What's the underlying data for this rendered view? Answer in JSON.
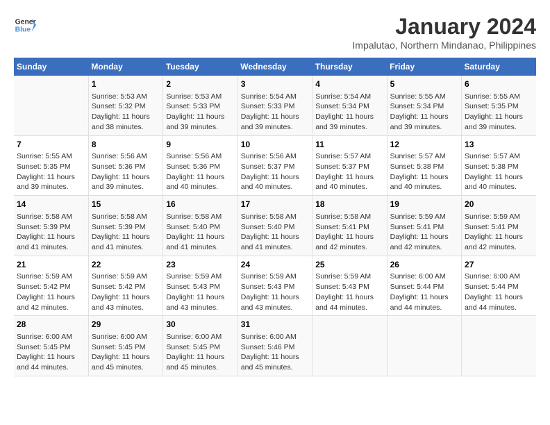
{
  "logo": {
    "line1": "General",
    "line2": "Blue"
  },
  "title": "January 2024",
  "subtitle": "Impalutao, Northern Mindanao, Philippines",
  "days_of_week": [
    "Sunday",
    "Monday",
    "Tuesday",
    "Wednesday",
    "Thursday",
    "Friday",
    "Saturday"
  ],
  "weeks": [
    [
      {
        "day": "",
        "info": ""
      },
      {
        "day": "1",
        "info": "Sunrise: 5:53 AM\nSunset: 5:32 PM\nDaylight: 11 hours\nand 38 minutes."
      },
      {
        "day": "2",
        "info": "Sunrise: 5:53 AM\nSunset: 5:33 PM\nDaylight: 11 hours\nand 39 minutes."
      },
      {
        "day": "3",
        "info": "Sunrise: 5:54 AM\nSunset: 5:33 PM\nDaylight: 11 hours\nand 39 minutes."
      },
      {
        "day": "4",
        "info": "Sunrise: 5:54 AM\nSunset: 5:34 PM\nDaylight: 11 hours\nand 39 minutes."
      },
      {
        "day": "5",
        "info": "Sunrise: 5:55 AM\nSunset: 5:34 PM\nDaylight: 11 hours\nand 39 minutes."
      },
      {
        "day": "6",
        "info": "Sunrise: 5:55 AM\nSunset: 5:35 PM\nDaylight: 11 hours\nand 39 minutes."
      }
    ],
    [
      {
        "day": "7",
        "info": "Sunrise: 5:55 AM\nSunset: 5:35 PM\nDaylight: 11 hours\nand 39 minutes."
      },
      {
        "day": "8",
        "info": "Sunrise: 5:56 AM\nSunset: 5:36 PM\nDaylight: 11 hours\nand 39 minutes."
      },
      {
        "day": "9",
        "info": "Sunrise: 5:56 AM\nSunset: 5:36 PM\nDaylight: 11 hours\nand 40 minutes."
      },
      {
        "day": "10",
        "info": "Sunrise: 5:56 AM\nSunset: 5:37 PM\nDaylight: 11 hours\nand 40 minutes."
      },
      {
        "day": "11",
        "info": "Sunrise: 5:57 AM\nSunset: 5:37 PM\nDaylight: 11 hours\nand 40 minutes."
      },
      {
        "day": "12",
        "info": "Sunrise: 5:57 AM\nSunset: 5:38 PM\nDaylight: 11 hours\nand 40 minutes."
      },
      {
        "day": "13",
        "info": "Sunrise: 5:57 AM\nSunset: 5:38 PM\nDaylight: 11 hours\nand 40 minutes."
      }
    ],
    [
      {
        "day": "14",
        "info": "Sunrise: 5:58 AM\nSunset: 5:39 PM\nDaylight: 11 hours\nand 41 minutes."
      },
      {
        "day": "15",
        "info": "Sunrise: 5:58 AM\nSunset: 5:39 PM\nDaylight: 11 hours\nand 41 minutes."
      },
      {
        "day": "16",
        "info": "Sunrise: 5:58 AM\nSunset: 5:40 PM\nDaylight: 11 hours\nand 41 minutes."
      },
      {
        "day": "17",
        "info": "Sunrise: 5:58 AM\nSunset: 5:40 PM\nDaylight: 11 hours\nand 41 minutes."
      },
      {
        "day": "18",
        "info": "Sunrise: 5:58 AM\nSunset: 5:41 PM\nDaylight: 11 hours\nand 42 minutes."
      },
      {
        "day": "19",
        "info": "Sunrise: 5:59 AM\nSunset: 5:41 PM\nDaylight: 11 hours\nand 42 minutes."
      },
      {
        "day": "20",
        "info": "Sunrise: 5:59 AM\nSunset: 5:41 PM\nDaylight: 11 hours\nand 42 minutes."
      }
    ],
    [
      {
        "day": "21",
        "info": "Sunrise: 5:59 AM\nSunset: 5:42 PM\nDaylight: 11 hours\nand 42 minutes."
      },
      {
        "day": "22",
        "info": "Sunrise: 5:59 AM\nSunset: 5:42 PM\nDaylight: 11 hours\nand 43 minutes."
      },
      {
        "day": "23",
        "info": "Sunrise: 5:59 AM\nSunset: 5:43 PM\nDaylight: 11 hours\nand 43 minutes."
      },
      {
        "day": "24",
        "info": "Sunrise: 5:59 AM\nSunset: 5:43 PM\nDaylight: 11 hours\nand 43 minutes."
      },
      {
        "day": "25",
        "info": "Sunrise: 5:59 AM\nSunset: 5:43 PM\nDaylight: 11 hours\nand 44 minutes."
      },
      {
        "day": "26",
        "info": "Sunrise: 6:00 AM\nSunset: 5:44 PM\nDaylight: 11 hours\nand 44 minutes."
      },
      {
        "day": "27",
        "info": "Sunrise: 6:00 AM\nSunset: 5:44 PM\nDaylight: 11 hours\nand 44 minutes."
      }
    ],
    [
      {
        "day": "28",
        "info": "Sunrise: 6:00 AM\nSunset: 5:45 PM\nDaylight: 11 hours\nand 44 minutes."
      },
      {
        "day": "29",
        "info": "Sunrise: 6:00 AM\nSunset: 5:45 PM\nDaylight: 11 hours\nand 45 minutes."
      },
      {
        "day": "30",
        "info": "Sunrise: 6:00 AM\nSunset: 5:45 PM\nDaylight: 11 hours\nand 45 minutes."
      },
      {
        "day": "31",
        "info": "Sunrise: 6:00 AM\nSunset: 5:46 PM\nDaylight: 11 hours\nand 45 minutes."
      },
      {
        "day": "",
        "info": ""
      },
      {
        "day": "",
        "info": ""
      },
      {
        "day": "",
        "info": ""
      }
    ]
  ]
}
